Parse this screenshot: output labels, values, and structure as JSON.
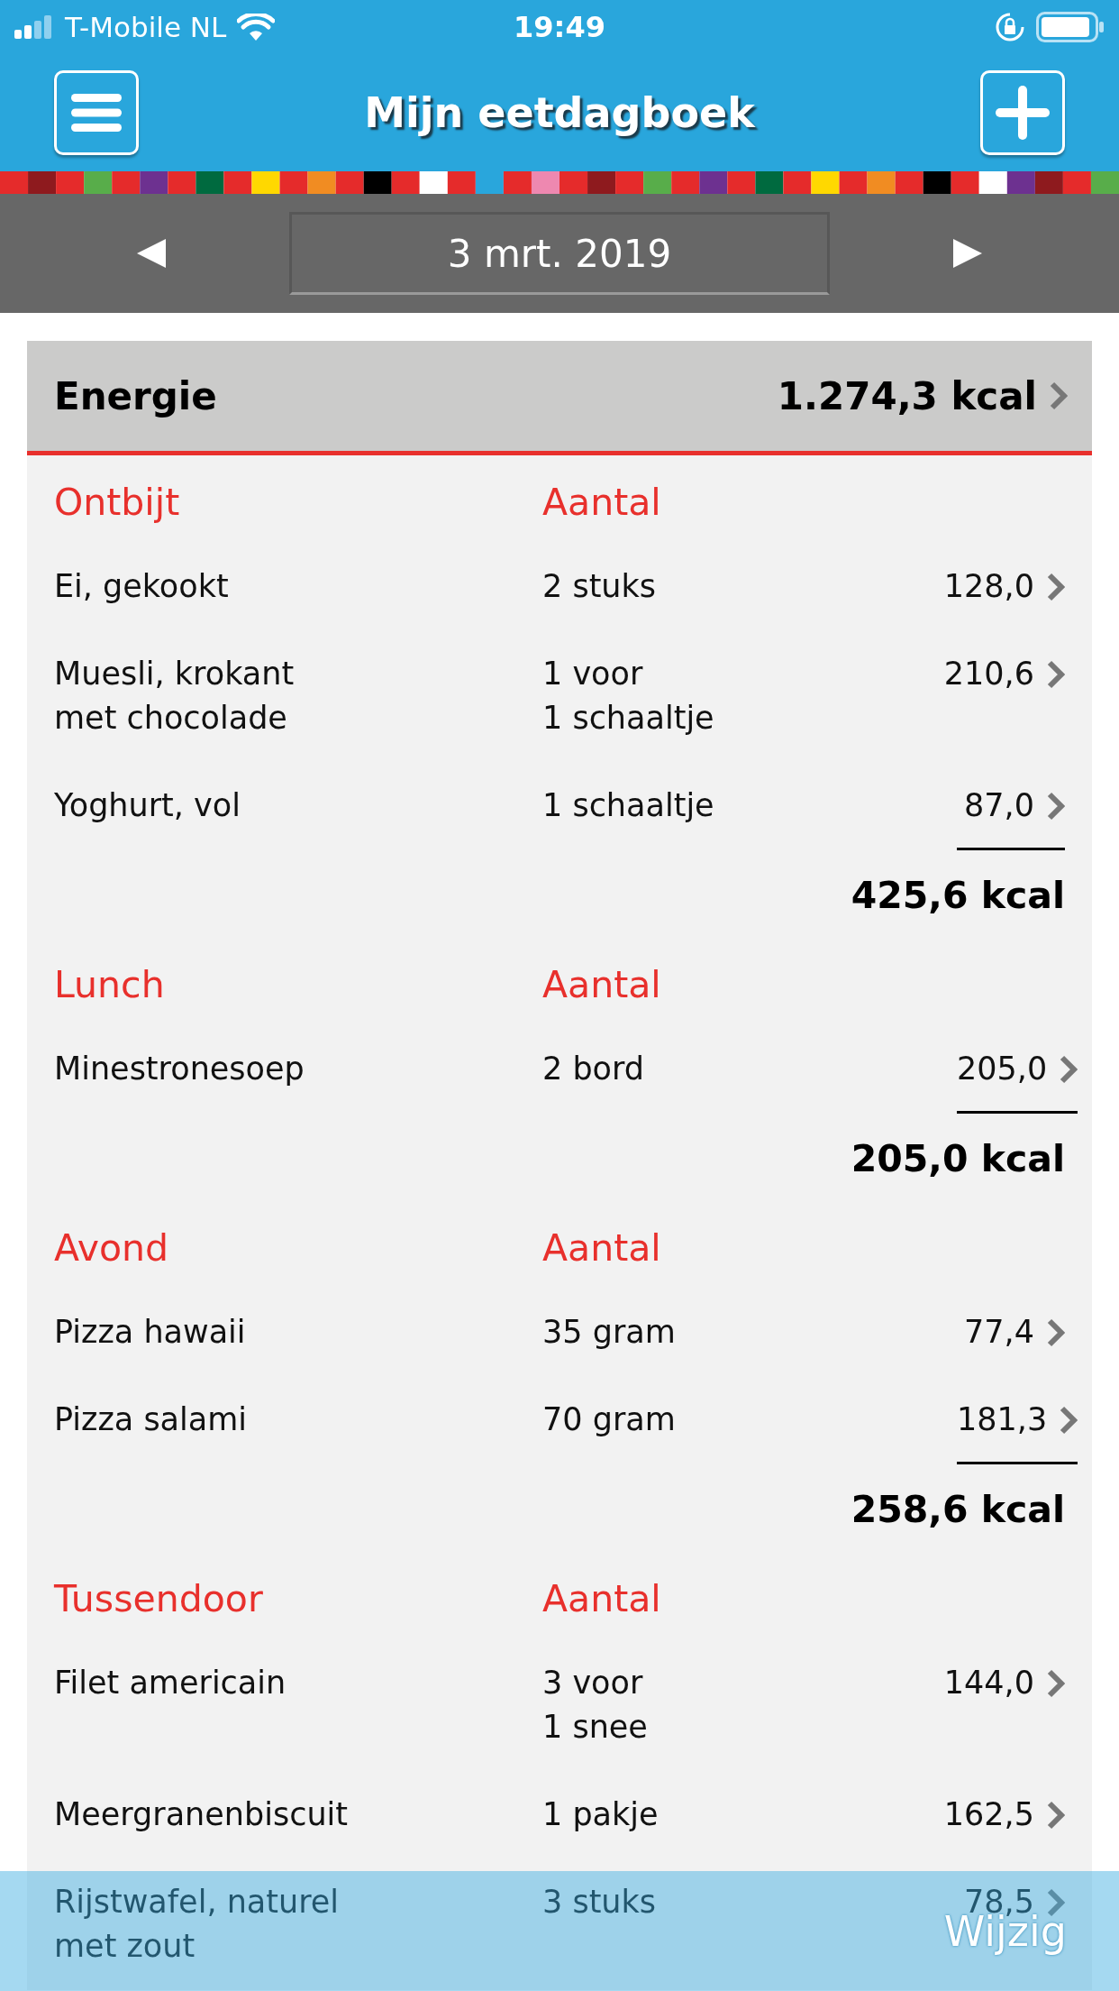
{
  "status_bar": {
    "carrier": "T-Mobile NL",
    "time": "19:49"
  },
  "header": {
    "title": "Mijn eetdagboek"
  },
  "date_nav": {
    "date": "3 mrt. 2019"
  },
  "energy": {
    "label": "Energie",
    "value": "1.274,3 kcal"
  },
  "sections": [
    {
      "title": "Ontbijt",
      "column": "Aantal",
      "total": "425,6 kcal",
      "items": [
        {
          "name": [
            "Ei, gekookt"
          ],
          "amount": [
            "2 stuks"
          ],
          "kcal": "128,0"
        },
        {
          "name": [
            "Muesli, krokant",
            "met chocolade"
          ],
          "amount": [
            "1 voor",
            "1 schaaltje"
          ],
          "kcal": "210,6"
        },
        {
          "name": [
            "Yoghurt, vol"
          ],
          "amount": [
            "1 schaaltje"
          ],
          "kcal": "87,0"
        }
      ]
    },
    {
      "title": "Lunch",
      "column": "Aantal",
      "total": "205,0 kcal",
      "items": [
        {
          "name": [
            "Minestronesoep"
          ],
          "amount": [
            "2 bord"
          ],
          "kcal": "205,0"
        }
      ]
    },
    {
      "title": "Avond",
      "column": "Aantal",
      "total": "258,6 kcal",
      "items": [
        {
          "name": [
            "Pizza hawaii"
          ],
          "amount": [
            "35 gram"
          ],
          "kcal": "77,4"
        },
        {
          "name": [
            "Pizza salami"
          ],
          "amount": [
            "70 gram"
          ],
          "kcal": "181,3"
        }
      ]
    },
    {
      "title": "Tussendoor",
      "column": "Aantal",
      "items": [
        {
          "name": [
            "Filet americain"
          ],
          "amount": [
            "3 voor",
            "1 snee"
          ],
          "kcal": "144,0"
        },
        {
          "name": [
            "Meergranenbiscuit"
          ],
          "amount": [
            "1 pakje"
          ],
          "kcal": "162,5"
        },
        {
          "name": [
            "Rijstwafel, naturel",
            "met zout"
          ],
          "amount": [
            "3 stuks"
          ],
          "kcal": "78,5"
        }
      ]
    }
  ],
  "bottom_bar": {
    "action": "Wijzig"
  }
}
